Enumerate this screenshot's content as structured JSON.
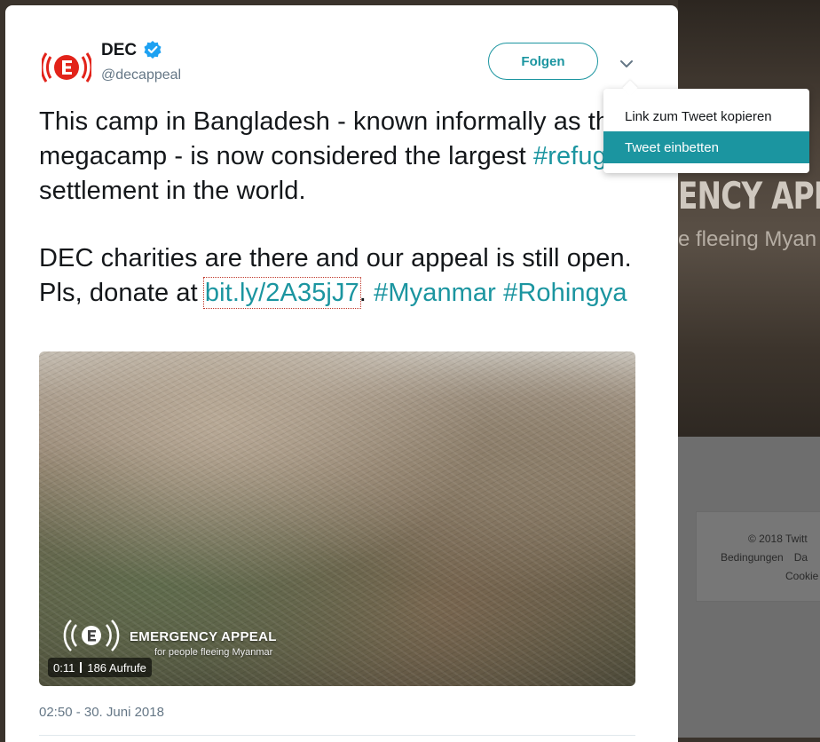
{
  "background": {
    "video_heading": "ENCY APP",
    "video_subheading": "e fleeing Myan",
    "footer": {
      "copyright": "© 2018 Twitt",
      "links": [
        "Bedingungen",
        "Da"
      ],
      "line3": "Cookie"
    }
  },
  "tweet": {
    "author": {
      "display_name": "DEC",
      "handle": "@decappeal",
      "verified": true
    },
    "follow_label": "Folgen",
    "text": {
      "p1_before": "This camp in Bangladesh - known informally as the megacamp - is now considered the largest ",
      "p1_hashtag": "#refugee",
      "p1_after": " settlement in the world.",
      "p2_before": "DEC charities are there and our appeal is still open. Pls, donate at ",
      "p2_link": "bit.ly/2A35jJ7",
      "p2_mid": ". ",
      "p2_hashtag1": "#Myanmar",
      "p2_hashtag2": "#Rohingya"
    },
    "media": {
      "brand_title": "EMERGENCY APPEAL",
      "brand_subtitle": "for people fleeing Myanmar",
      "duration": "0:11",
      "views": "186 Aufrufe"
    },
    "timestamp": "02:50 - 30. Juni 2018"
  },
  "menu": {
    "items": [
      {
        "label": "Link zum Tweet kopieren"
      },
      {
        "label": "Tweet einbetten"
      }
    ],
    "highlighted_index": 1
  },
  "colors": {
    "accent": "#1b95a0",
    "brand_red": "#e2231a",
    "verified_blue": "#1da1f2"
  }
}
